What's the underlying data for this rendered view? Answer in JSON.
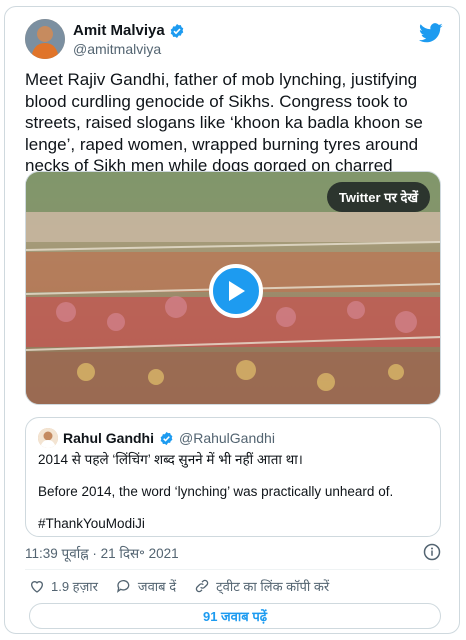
{
  "author": {
    "name": "Amit Malviya",
    "handle": "@amitmalviya"
  },
  "tweet": {
    "text": "Meet Rajiv Gandhi, father of mob lynching, justifying blood curdling genocide of Sikhs. Congress took to streets, raised slogans like ‘khoon ka badla khoon se lenge’, raped women, wrapped burning tyres around necks of Sikh men while dogs gorged on charred bodies dumped in drains."
  },
  "media": {
    "watch_label": "Twitter पर देखें"
  },
  "quote": {
    "name": "Rahul Gandhi",
    "handle": "@RahulGandhi",
    "line1": "2014 से पहले ‘लिंचिंग’ शब्द सुनने में भी नहीं आता था।",
    "line2": "Before 2014, the word ‘lynching’ was practically unheard of.",
    "line3": "#ThankYouModiJi"
  },
  "meta": {
    "timestamp": "11:39 पूर्वाह्न · 21 दिस॰ 2021"
  },
  "actions": {
    "likes": "1.9 हज़ार",
    "reply": "जवाब दें",
    "copy_link": "ट्वीट का लिंक कॉपी करें"
  },
  "replies_button": "91 जवाब पढ़ें",
  "colors": {
    "accent": "#1d9bf0",
    "verified": "#1d9bf0",
    "like_red": "#f91880"
  }
}
